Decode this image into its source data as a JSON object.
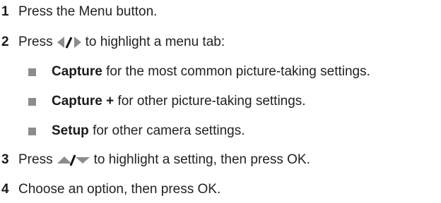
{
  "steps": [
    {
      "number": "1",
      "text": "Press the Menu button."
    },
    {
      "number": "2",
      "prefix": "Press",
      "icon": "left-right-arrow-icon",
      "suffix": "to highlight a menu tab:"
    },
    {
      "number": "3",
      "prefix": "Press",
      "icon": "up-down-arrow-icon",
      "suffix": "to highlight a setting, then press OK."
    },
    {
      "number": "4",
      "text": "Choose an option, then press OK."
    }
  ],
  "tabs": [
    {
      "term": "Capture",
      "desc": "for the most common picture-taking settings."
    },
    {
      "term": "Capture +",
      "desc": "for other picture-taking settings."
    },
    {
      "term": "Setup",
      "desc": "for other camera settings."
    }
  ],
  "colors": {
    "text": "#222222",
    "icon": "#8c8c8c",
    "separator": "#111111",
    "bullet": "#8c8c8c"
  }
}
